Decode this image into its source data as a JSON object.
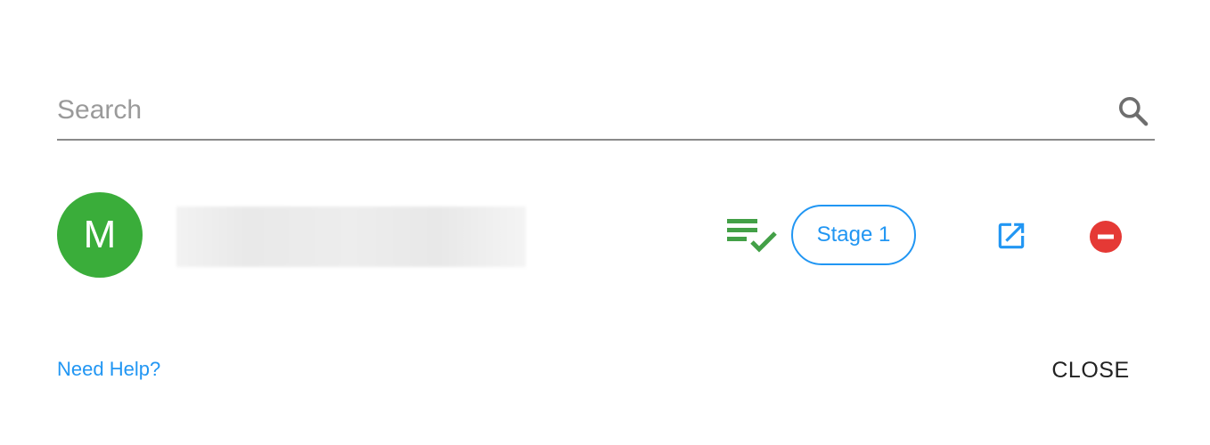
{
  "search": {
    "placeholder": "Search",
    "value": "",
    "icon": "search-icon"
  },
  "member": {
    "avatar_initial": "M",
    "avatar_color": "#3aad3a",
    "name_blurred": true,
    "status_icon": "playlist-check-icon",
    "stage_label": "Stage 1",
    "open_icon": "open-in-new-icon",
    "remove_icon": "remove-circle-icon"
  },
  "footer": {
    "help_label": "Need Help?",
    "close_label": "CLOSE"
  },
  "colors": {
    "accent": "#2196f3",
    "success": "#43a047",
    "danger": "#e53935"
  }
}
